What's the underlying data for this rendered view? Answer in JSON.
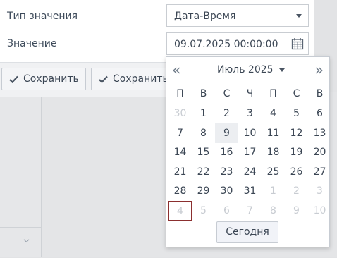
{
  "form": {
    "type_label": "Тип значения",
    "type_value": "Дата-Время",
    "value_label": "Значение",
    "value_value": "09.07.2025 00:00:00"
  },
  "footer": {
    "save_label": "Сохранить",
    "save_close_label": "Сохранить"
  },
  "calendar": {
    "prev": "«",
    "next": "»",
    "month_label": "Июль 2025",
    "weekdays": [
      "П",
      "В",
      "С",
      "Ч",
      "П",
      "С",
      "В"
    ],
    "days": [
      [
        "30",
        "1",
        "2",
        "3",
        "4",
        "5",
        "6"
      ],
      [
        "7",
        "8",
        "9",
        "10",
        "11",
        "12",
        "13"
      ],
      [
        "14",
        "15",
        "16",
        "17",
        "18",
        "19",
        "20"
      ],
      [
        "21",
        "22",
        "23",
        "24",
        "25",
        "26",
        "27"
      ],
      [
        "28",
        "29",
        "30",
        "31",
        "1",
        "2",
        "3"
      ],
      [
        "4",
        "5",
        "6",
        "7",
        "8",
        "9",
        "10"
      ]
    ],
    "other_month_cells": [
      [
        0,
        0
      ],
      [
        4,
        4
      ],
      [
        4,
        5
      ],
      [
        4,
        6
      ],
      [
        5,
        0
      ],
      [
        5,
        1
      ],
      [
        5,
        2
      ],
      [
        5,
        3
      ],
      [
        5,
        4
      ],
      [
        5,
        5
      ],
      [
        5,
        6
      ]
    ],
    "selected_cell": [
      1,
      2
    ],
    "today_cell": [
      5,
      0
    ],
    "today_button": "Сегодня"
  },
  "colors": {
    "accent_today_border": "#8b2f2f",
    "selected_bg": "#eceef1"
  }
}
